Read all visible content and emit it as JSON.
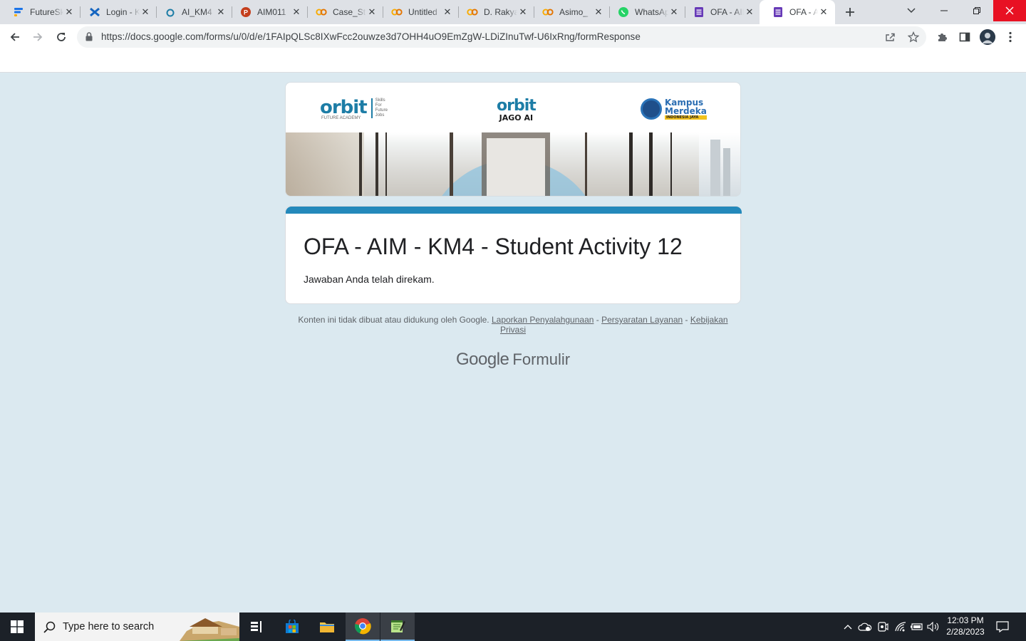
{
  "browser": {
    "tabs": [
      {
        "title": "FutureSkills",
        "icon": "futureskills-icon",
        "color": "#1a73e8"
      },
      {
        "title": "Login - Kampus",
        "icon": "kampus-merdeka-icon",
        "color": "#1565c0"
      },
      {
        "title": "AI_KM4",
        "icon": "orbit-icon",
        "color": "#1d7da6"
      },
      {
        "title": "AIM011",
        "icon": "powerpoint-icon",
        "color": "#c43e1c"
      },
      {
        "title": "Case_Study",
        "icon": "colab-icon",
        "color": "#f9ab00"
      },
      {
        "title": "Untitled",
        "icon": "colab-icon",
        "color": "#f9ab00"
      },
      {
        "title": "D. Rakyat",
        "icon": "colab-icon",
        "color": "#f9ab00"
      },
      {
        "title": "Asimo_",
        "icon": "colab-icon",
        "color": "#f9ab00"
      },
      {
        "title": "WhatsApp",
        "icon": "whatsapp-icon",
        "color": "#25d366"
      },
      {
        "title": "OFA - AIM",
        "icon": "google-forms-icon",
        "color": "#673ab7"
      },
      {
        "title": "OFA - AIM",
        "icon": "google-forms-icon",
        "color": "#673ab7",
        "active": true
      }
    ],
    "url": "https://docs.google.com/forms/u/0/d/e/1FAIpQLSc8IXwFcc2ouwze3d7OHH4uO9EmZgW-LDiZInuTwf-U6IxRng/formResponse"
  },
  "header": {
    "orbit": {
      "word": "orbit",
      "sub": "FUTURE ACADEMY",
      "skills": [
        "Skills",
        "For",
        "Future",
        "Jobs"
      ]
    },
    "jago": {
      "word": "orbit",
      "sub": "JAGO AI"
    },
    "km": {
      "line1": "Kampus",
      "line2": "Merdeka",
      "band": "INDONESIA JAYA"
    }
  },
  "form": {
    "title": "OFA - AIM - KM4 - Student Activity 12",
    "message": "Jawaban Anda telah direkam."
  },
  "footer": {
    "note": "Konten ini tidak dibuat atau didukung oleh Google.",
    "abuse_link": "Laporkan Penyalahgunaan",
    "sep": " - ",
    "terms_link": "Persyaratan Layanan",
    "privacy_link": "Kebijakan Privasi",
    "brand_google": "Google",
    "brand_product": "Formulir"
  },
  "taskbar": {
    "search_placeholder": "Type here to search",
    "time": "12:03 PM",
    "date": "2/28/2023"
  },
  "colors": {
    "accent": "#2489bb",
    "page_bg": "#dbe9f0"
  }
}
